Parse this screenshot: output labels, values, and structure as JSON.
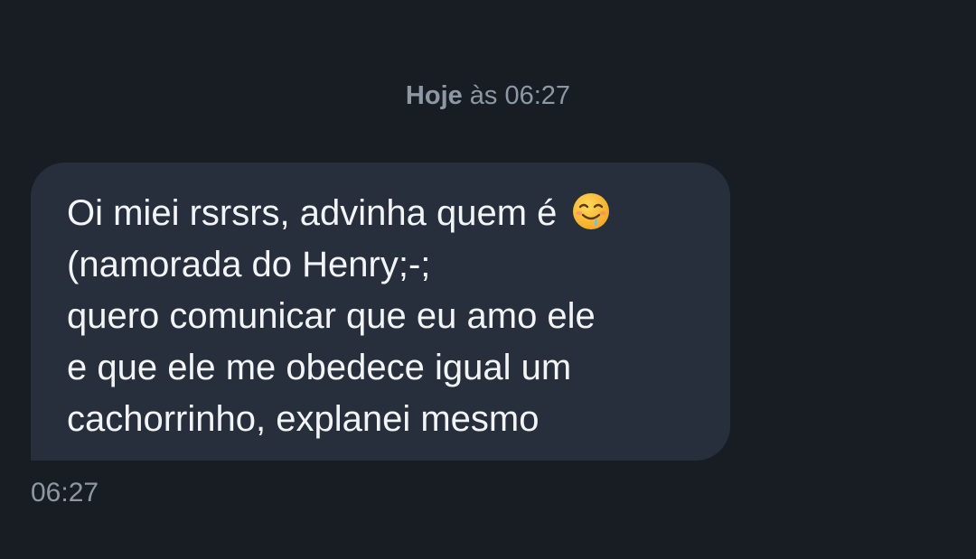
{
  "date_separator": {
    "day": "Hoje",
    "rest": " às 06:27"
  },
  "message": {
    "lines": [
      "Oi miei rsrsrs, advinha quem é",
      "(namorada do Henry;-;",
      "quero comunicar que eu amo ele",
      "e que ele me obedece igual um",
      "cachorrinho, explanei mesmo"
    ],
    "emoji": "drooling-face-icon",
    "time": "06:27"
  },
  "colors": {
    "background": "#181d24",
    "bubble": "#262f3b",
    "text": "#f2f4f6",
    "muted": "#8e98a4"
  }
}
